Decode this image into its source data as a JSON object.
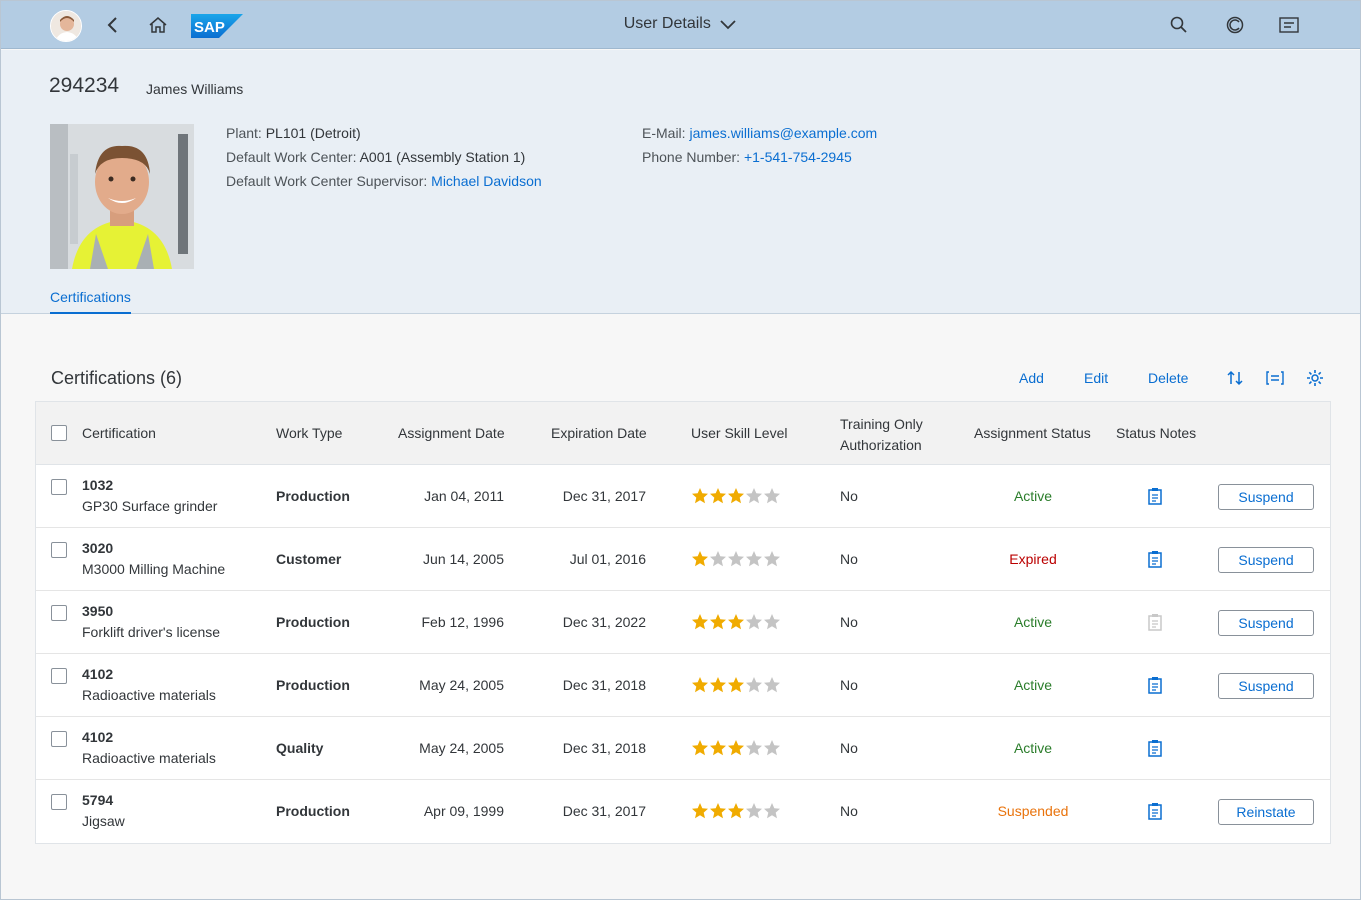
{
  "shell": {
    "title": "User Details",
    "icons": [
      "avatar",
      "back-icon",
      "home-icon",
      "sap-logo",
      "chevron-down-icon",
      "search-icon",
      "copilot-icon",
      "notifications-icon"
    ]
  },
  "header": {
    "id": "294234",
    "name": "James Williams",
    "plant_label": "Plant:",
    "plant_value": "PL101 (Detroit)",
    "wc_label": "Default Work Center:",
    "wc_value": "A001 (Assembly Station 1)",
    "sup_label": "Default Work Center Supervisor:",
    "sup_value": "Michael Davidson",
    "email_label": "E-Mail:",
    "email_value": "james.williams@example.com",
    "phone_label": "Phone Number:",
    "phone_value": "+1-541-754-2945",
    "tab": "Certifications"
  },
  "table": {
    "title": "Certifications (6)",
    "toolbar": {
      "add": "Add",
      "edit": "Edit",
      "delete": "Delete"
    },
    "columns": {
      "certification": "Certification",
      "work_type": "Work Type",
      "assignment_date": "Assignment Date",
      "expiration_date": "Expiration Date",
      "skill": "User Skill Level",
      "training_1": "Training Only",
      "training_2": "Authorization",
      "status": "Assignment Status",
      "notes": "Status Notes"
    },
    "rows": [
      {
        "code": "1032",
        "name": "GP30 Surface grinder",
        "work_type": "Production",
        "assigned": "Jan 04, 2011",
        "expires": "Dec 31, 2017",
        "stars": 3,
        "training": "No",
        "status": "Active",
        "status_kind": "active",
        "notes_enabled": true,
        "action": "Suspend"
      },
      {
        "code": "3020",
        "name": "M3000 Milling Machine",
        "work_type": "Customer",
        "assigned": "Jun 14, 2005",
        "expires": "Jul 01, 2016",
        "stars": 1,
        "training": "No",
        "status": "Expired",
        "status_kind": "expired",
        "notes_enabled": true,
        "action": "Suspend"
      },
      {
        "code": "3950",
        "name": "Forklift driver's license",
        "work_type": "Production",
        "assigned": "Feb 12, 1996",
        "expires": "Dec 31, 2022",
        "stars": 3,
        "training": "No",
        "status": "Active",
        "status_kind": "active",
        "notes_enabled": false,
        "action": "Suspend"
      },
      {
        "code": "4102",
        "name": "Radioactive materials",
        "work_type": "Production",
        "assigned": "May 24, 2005",
        "expires": "Dec 31, 2018",
        "stars": 3,
        "training": "No",
        "status": "Active",
        "status_kind": "active",
        "notes_enabled": true,
        "action": "Suspend"
      },
      {
        "code": "4102",
        "name": "Radioactive materials",
        "work_type": "Quality",
        "assigned": "May 24, 2005",
        "expires": "Dec 31, 2018",
        "stars": 3,
        "training": "No",
        "status": "Active",
        "status_kind": "active",
        "notes_enabled": true,
        "action": ""
      },
      {
        "code": "5794",
        "name": "Jigsaw",
        "work_type": "Production",
        "assigned": "Apr 09, 1999",
        "expires": "Dec 31, 2017",
        "stars": 3,
        "training": "No",
        "status": "Suspended",
        "status_kind": "suspended",
        "notes_enabled": true,
        "action": "Reinstate"
      }
    ],
    "max_stars": 5
  },
  "colors": {
    "shell_bg": "#b3cce3",
    "header_bg": "#e9eff5",
    "link": "#0a6ed1",
    "star_on": "#f0ab00",
    "star_off": "#c4c4c4",
    "active": "#2b7d2b",
    "expired": "#bb0000",
    "suspended": "#e9730c"
  }
}
